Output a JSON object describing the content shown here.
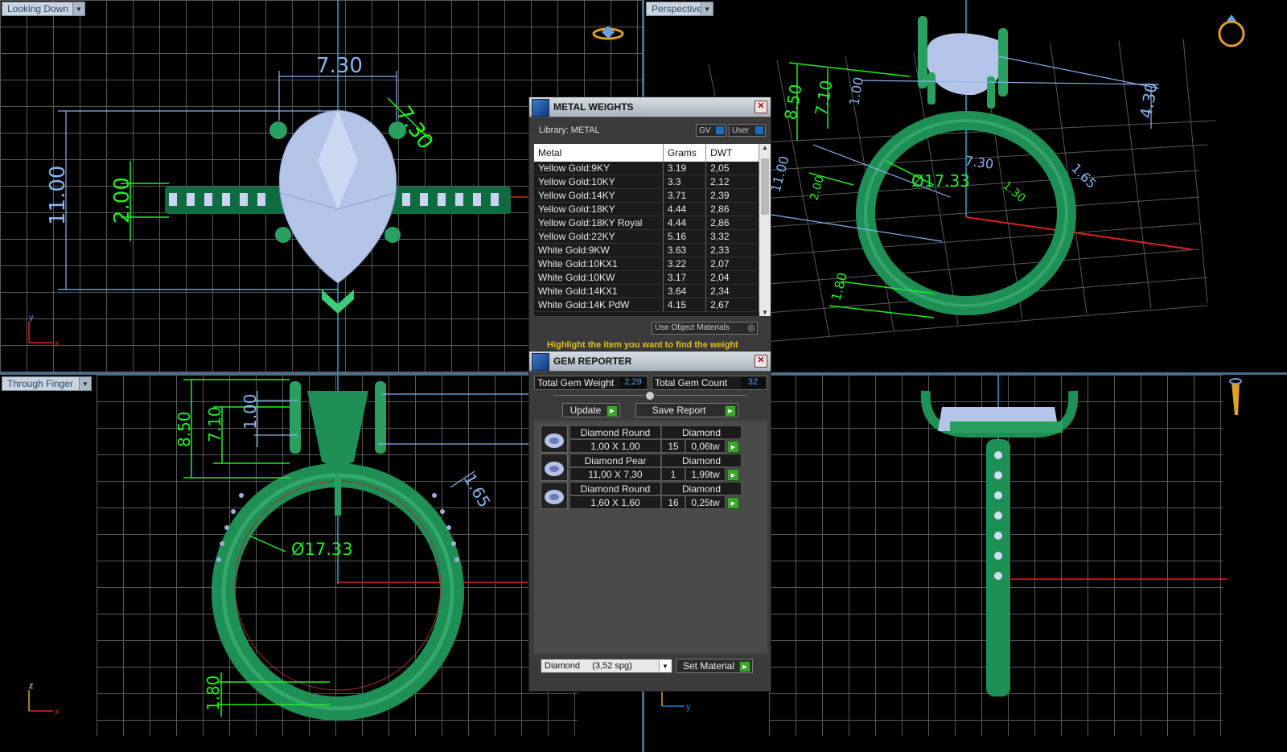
{
  "viewports": {
    "top_left": {
      "label": "Looking Down",
      "dims": {
        "width": "7.30",
        "height": "11.00",
        "band": "2.00",
        "angled": "7.30"
      }
    },
    "top_right": {
      "label": "Perspective",
      "dims": {
        "a": "8.50",
        "b": "7.10",
        "c": "1.00",
        "d": "4.30",
        "diam": "Ø17.33",
        "w": "7.30",
        "e": "1.65",
        "f": "11.00",
        "g": "2.00",
        "h": "1.80",
        "i": "1.30"
      }
    },
    "bottom_left": {
      "label": "Through Finger",
      "dims": {
        "a": "8.50",
        "b": "7.10",
        "c": "1.00",
        "diam": "Ø17.33",
        "e": "1.65",
        "h": "1.80"
      }
    },
    "bottom_right": {
      "label": ""
    }
  },
  "axes": {
    "x": "x",
    "y": "y",
    "z": "z"
  },
  "metal_weights": {
    "title": "METAL WEIGHTS",
    "library": "Library: METAL",
    "gv_label": "GV",
    "user_label": "User",
    "columns": [
      "Metal",
      "Grams",
      "DWT"
    ],
    "rows": [
      [
        "Yellow Gold:9KY",
        "3.19",
        "2,05"
      ],
      [
        "Yellow Gold:10KY",
        "3.3",
        "2,12"
      ],
      [
        "Yellow Gold:14KY",
        "3.71",
        "2,39"
      ],
      [
        "Yellow Gold:18KY",
        "4.44",
        "2,86"
      ],
      [
        "Yellow Gold:18KY Royal",
        "4.44",
        "2,86"
      ],
      [
        "Yellow Gold:22KY",
        "5.16",
        "3,32"
      ],
      [
        "White Gold:9KW",
        "3.63",
        "2,33"
      ],
      [
        "White Gold:10KX1",
        "3.22",
        "2,07"
      ],
      [
        "White Gold:10KW",
        "3.17",
        "2,04"
      ],
      [
        "White Gold:14KX1",
        "3.64",
        "2,34"
      ],
      [
        "White Gold:14K PdW",
        "4.15",
        "2,67"
      ]
    ],
    "use_object_materials": "Use Object Materials",
    "hint": "Highlight the item you want to find the weight"
  },
  "gem_reporter": {
    "title": "GEM REPORTER",
    "total_weight_label": "Total Gem Weight",
    "total_weight_value": "2,29",
    "total_count_label": "Total Gem Count",
    "total_count_value": "32",
    "update_label": "Update",
    "save_report_label": "Save Report",
    "gems": [
      {
        "name": "Diamond Round",
        "material": "Diamond",
        "size": "1,00 X 1,00",
        "count": "15",
        "weight": "0,06tw"
      },
      {
        "name": "Diamond Pear",
        "material": "Diamond",
        "size": "11,00 X 7,30",
        "count": "1",
        "weight": "1,99tw"
      },
      {
        "name": "Diamond Round",
        "material": "Diamond",
        "size": "1,60 X 1,60",
        "count": "16",
        "weight": "0,25tw"
      }
    ],
    "material_select": "Diamond     (3,52 spg)",
    "set_material_label": "Set Material"
  },
  "colors": {
    "dim_blue": "#8ab4f0",
    "dim_green": "#22ee22",
    "metal": "#1e8f55",
    "gem": "#b8c8e8",
    "axis_red": "#e02020"
  }
}
